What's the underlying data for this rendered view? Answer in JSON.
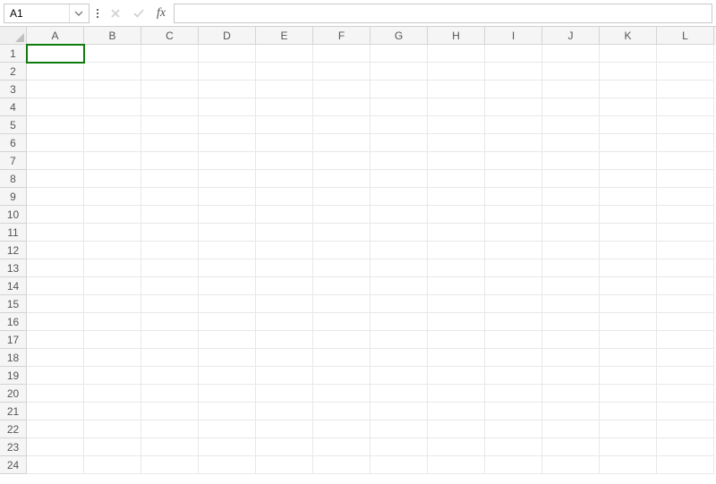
{
  "nameBox": {
    "value": "A1"
  },
  "formulaInput": {
    "value": ""
  },
  "fxLabel": "fx",
  "columns": [
    "A",
    "B",
    "C",
    "D",
    "E",
    "F",
    "G",
    "H",
    "I",
    "J",
    "K",
    "L"
  ],
  "rows": [
    "1",
    "2",
    "3",
    "4",
    "5",
    "6",
    "7",
    "8",
    "9",
    "10",
    "11",
    "12",
    "13",
    "14",
    "15",
    "16",
    "17",
    "18",
    "19",
    "20",
    "21",
    "22",
    "23",
    "24"
  ],
  "activeCell": "A1"
}
